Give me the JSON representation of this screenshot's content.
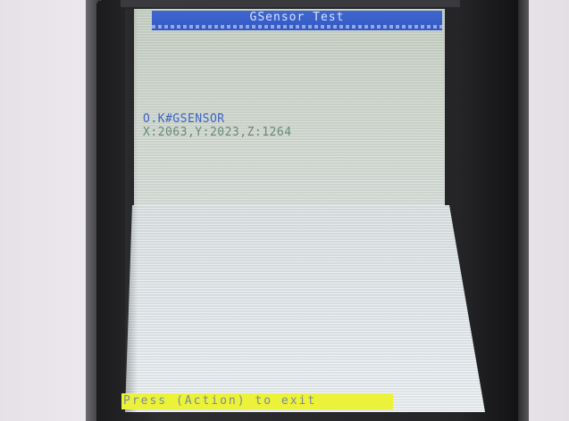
{
  "screen": {
    "title": "GSensor Test",
    "status": "O.K#GSENSOR",
    "readings": "X:2063,Y:2023,Z:1264",
    "footer": "Press (Action) to exit"
  },
  "colors": {
    "title_bar": "#3358c2",
    "status_text": "#3f63c4",
    "readings_text": "#6b8a76",
    "footer_bar": "#ecf23a",
    "screen_bg": "#d5ddd6"
  }
}
